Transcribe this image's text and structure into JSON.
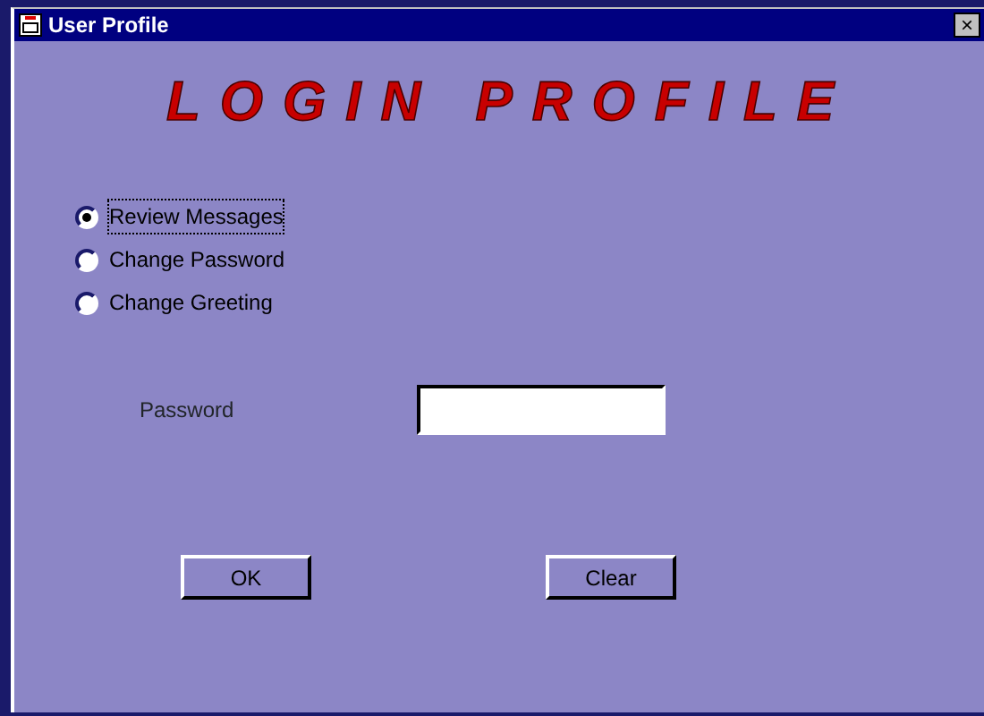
{
  "window": {
    "title": "User Profile",
    "close": "×"
  },
  "heading": "LOGIN PROFILE",
  "options": [
    {
      "label": "Review Messages",
      "selected": true
    },
    {
      "label": "Change Password",
      "selected": false
    },
    {
      "label": "Change Greeting",
      "selected": false
    }
  ],
  "password": {
    "label": "Password"
  },
  "buttons": [
    "OK",
    "Clear"
  ]
}
